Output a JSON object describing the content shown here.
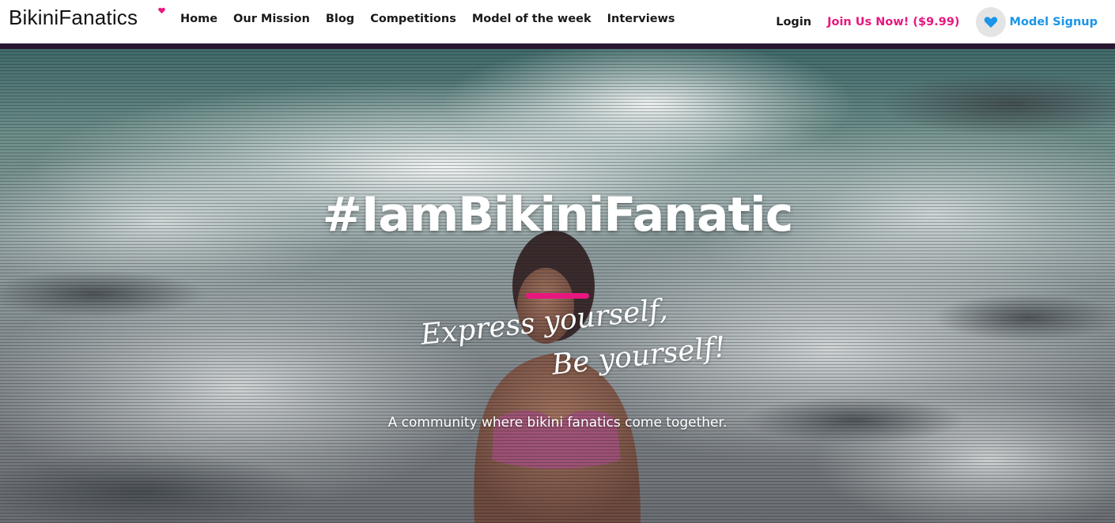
{
  "header": {
    "logo_text": "BikiniFanatics",
    "nav": [
      {
        "label": "Home"
      },
      {
        "label": "Our Mission"
      },
      {
        "label": "Blog"
      },
      {
        "label": "Competitions"
      },
      {
        "label": "Model of the week"
      },
      {
        "label": "Interviews"
      }
    ],
    "login_label": "Login",
    "join_label": "Join Us Now! ($9.99)",
    "model_signup_label": "Model Signup",
    "model_signup_icon": "heart-icon"
  },
  "hero": {
    "title": "#IamBikiniFanatic",
    "script_line1": "Express yourself,",
    "script_line2": "Be yourself!",
    "subtitle": "A community where bikini fanatics come together."
  },
  "colors": {
    "accent_pink": "#e8177f",
    "accent_blue": "#1a95e8",
    "text_dark": "#1a1a1a"
  }
}
